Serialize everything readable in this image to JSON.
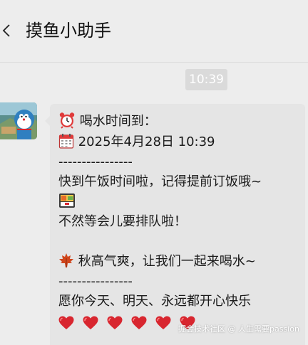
{
  "header": {
    "title": "摸鱼小助手",
    "back_icon": "chevron-left-icon"
  },
  "timestamp": "10:39",
  "message": {
    "sender_avatar": "cartoon-avatar",
    "line1": "喝水时间到：",
    "line1_icon": "alarm-clock-icon",
    "line2": "2025年4月28日 10:39",
    "line2_icon": "calendar-icon",
    "divider1": "----------------",
    "line3": "快到午饭时间啦，记得提前订饭哦~",
    "line4_icon": "bento-box-icon",
    "line5": "不然等会儿要排队啦！",
    "line6": "秋高气爽，让我们一起来喝水~",
    "line6_icon": "maple-leaf-icon",
    "divider2": "----------------",
    "line7": "愿你今天、明天、永远都开心快乐",
    "hearts_icon": "red-heart-icon",
    "heart_count": 6
  },
  "watermark": "掘金技术社区 @ 人生需要passion",
  "colors": {
    "background": "#ededed",
    "bubble": "#e5e5e5",
    "time_badge": "#dadada",
    "heart": "#d8262f"
  }
}
